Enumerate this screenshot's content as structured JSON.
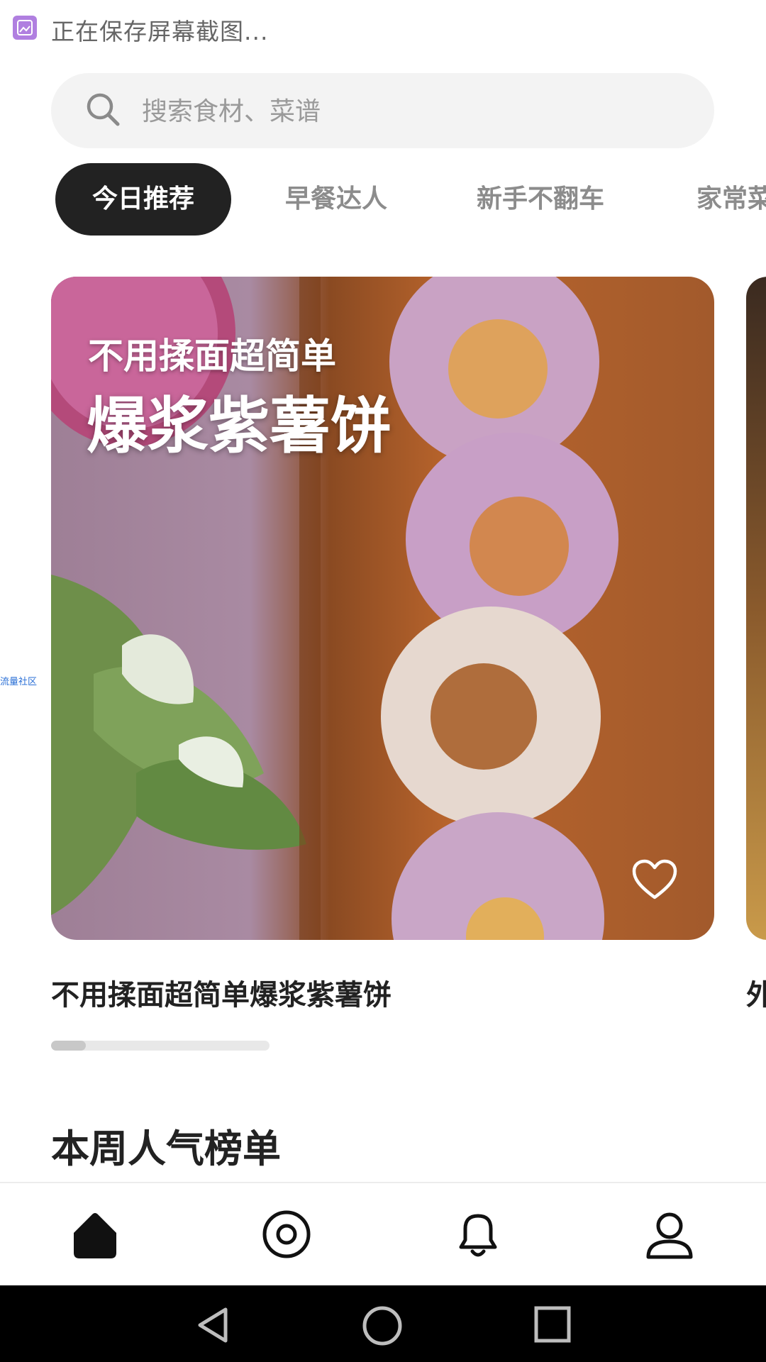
{
  "status_bar": {
    "text": "正在保存屏幕截图...",
    "icon": "screenshot-icon"
  },
  "search": {
    "placeholder": "搜索食材、菜谱",
    "icon": "search-icon"
  },
  "tabs": [
    {
      "label": "今日推荐",
      "active": true
    },
    {
      "label": "早餐达人",
      "active": false
    },
    {
      "label": "新手不翻车",
      "active": false
    },
    {
      "label": "家常菜",
      "active": false
    }
  ],
  "featured": {
    "overlay_subtitle": "不用揉面超简单",
    "overlay_title": "爆浆紫薯饼",
    "title": "不用揉面超简单爆浆紫薯饼",
    "next_title": "外",
    "carousel_progress": 0.16
  },
  "side_label": "流量社区",
  "section": {
    "title": "本周人气榜单"
  },
  "bottom_nav": [
    {
      "icon": "home-icon",
      "active": true
    },
    {
      "icon": "explore-icon",
      "active": false
    },
    {
      "icon": "bell-icon",
      "active": false
    },
    {
      "icon": "profile-icon",
      "active": false
    }
  ],
  "system_nav": [
    "back-icon",
    "home-circle-icon",
    "recents-icon"
  ],
  "colors": {
    "accent_dark": "#222222",
    "tab_inactive": "#8c8c8c",
    "search_bg": "#f3f3f3"
  }
}
